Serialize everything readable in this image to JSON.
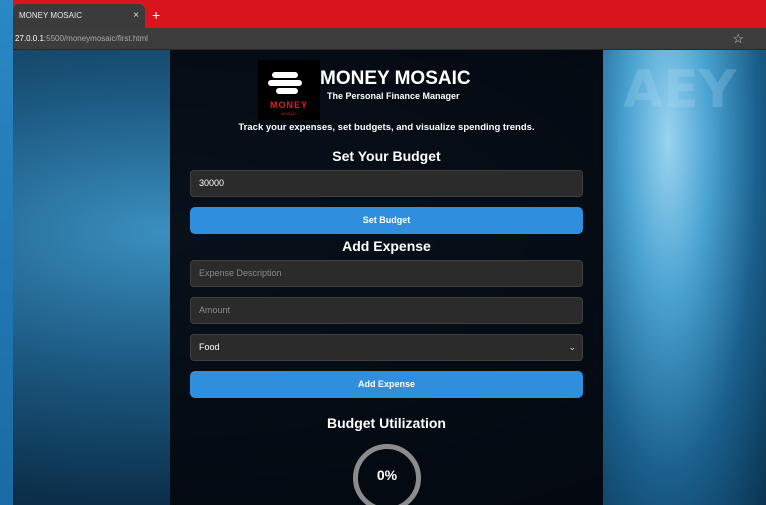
{
  "browser": {
    "tab_title": "MONEY MOSAIC",
    "tab_close": "×",
    "new_tab": "+",
    "url_host": "27.0.0.1",
    "url_path": ":5500/moneymosaic/first.html",
    "star": "☆"
  },
  "background": {
    "right_text": "AEY"
  },
  "header": {
    "logo_word": "MONEY",
    "logo_sub": "MOSAIC",
    "title": "MONEY MOSAIC",
    "tagline": "The Personal Finance Manager",
    "description": "Track your expenses, set budgets, and visualize spending trends."
  },
  "budget": {
    "heading": "Set Your Budget",
    "value": "30000",
    "button": "Set Budget"
  },
  "expense": {
    "heading": "Add Expense",
    "description_placeholder": "Expense Description",
    "amount_placeholder": "Amount",
    "category": "Food",
    "button": "Add Expense"
  },
  "utilization": {
    "heading": "Budget Utilization",
    "percent": "0%"
  },
  "colors": {
    "tab_bar": "#d8141c",
    "button": "#2f8fde",
    "panel": "#04080e"
  }
}
